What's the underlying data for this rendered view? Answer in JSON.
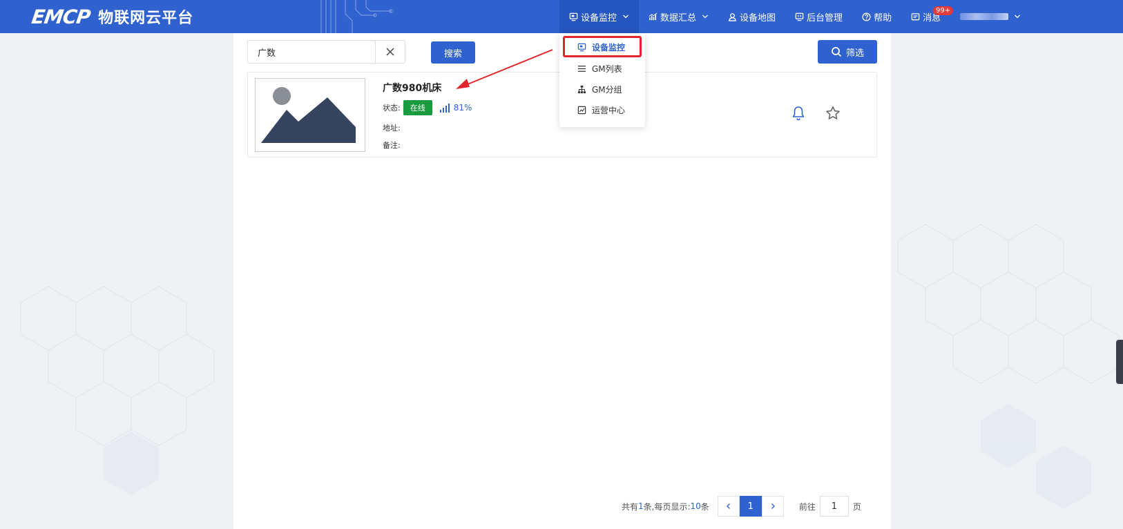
{
  "header": {
    "logo_mark": "EMCP",
    "logo_name": "物联网云平台",
    "nav": [
      {
        "label": "设备监控",
        "icon": "monitor-icon",
        "has_dropdown": true,
        "active": true
      },
      {
        "label": "数据汇总",
        "icon": "chart-icon",
        "has_dropdown": true
      },
      {
        "label": "设备地图",
        "icon": "map-user-icon"
      },
      {
        "label": "后台管理",
        "icon": "admin-icon"
      },
      {
        "label": "帮助",
        "icon": "help-icon"
      },
      {
        "label": "消息",
        "icon": "message-icon",
        "badge": "99+"
      }
    ]
  },
  "dropdown": {
    "items": [
      {
        "label": "设备监控",
        "icon": "monitor-icon",
        "selected": true
      },
      {
        "label": "GM列表",
        "icon": "list-icon"
      },
      {
        "label": "GM分组",
        "icon": "group-tree-icon"
      },
      {
        "label": "运营中心",
        "icon": "operation-chart-icon"
      }
    ]
  },
  "search": {
    "value": "广数",
    "search_label": "搜索",
    "filter_label": "筛选"
  },
  "device": {
    "name": "广数980机床",
    "status_label": "状态:",
    "status_value": "在线",
    "signal": "81%",
    "address_label": "地址:",
    "address_value": "",
    "note_label": "备注:",
    "note_value": ""
  },
  "pagination": {
    "total_prefix": "共有",
    "total": "1",
    "total_suffix": "条,每页显示:",
    "page_size": "10",
    "page_size_suffix": "条",
    "current_page": "1",
    "goto_prefix": "前往",
    "goto_value": "1",
    "goto_suffix": "页"
  },
  "colors": {
    "primary": "#2f62cf",
    "online": "#1a9b3f",
    "highlight": "#e0262c"
  }
}
